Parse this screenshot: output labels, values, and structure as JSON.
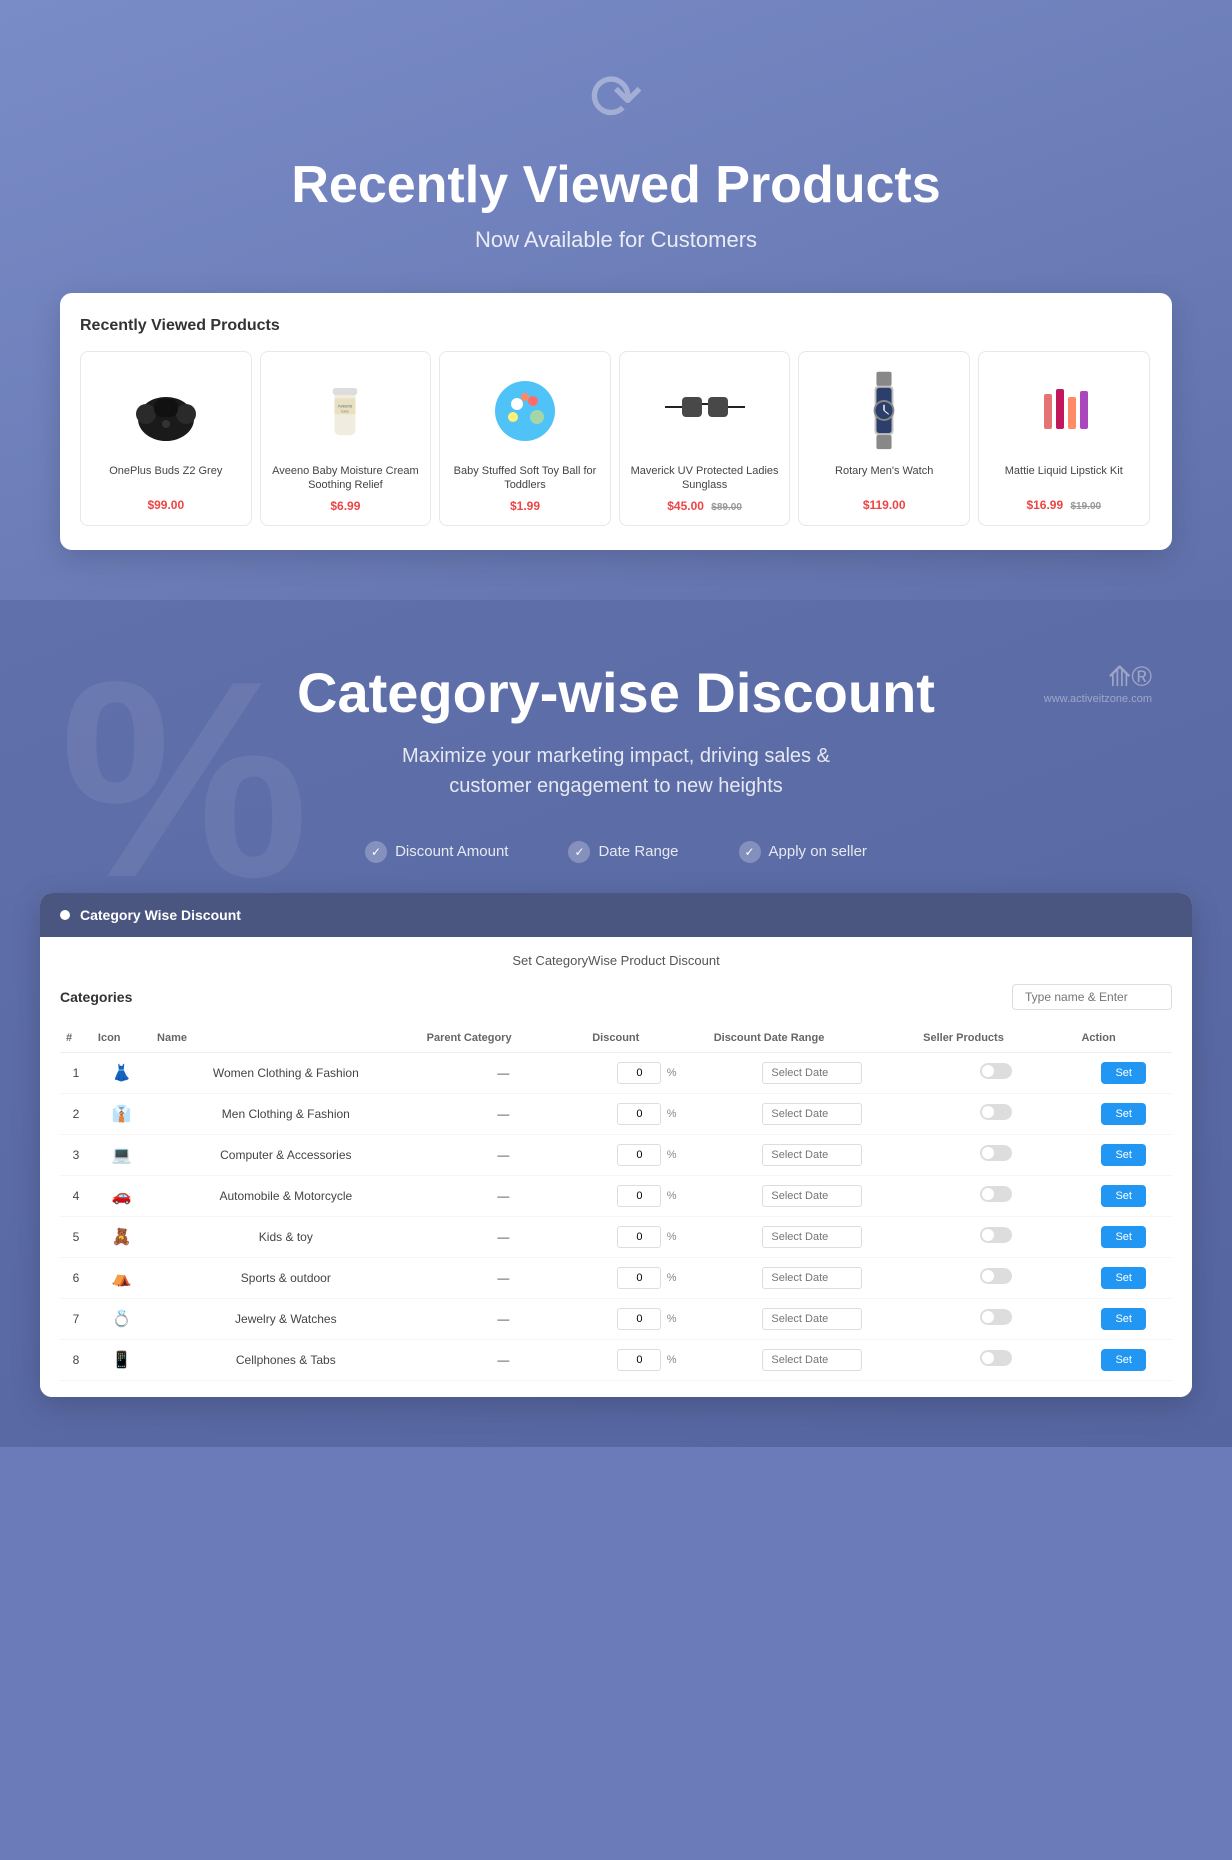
{
  "section1": {
    "icon": "↺",
    "title": "Recently Viewed Products",
    "subtitle": "Now Available for Customers",
    "panel_title": "Recently Viewed Products",
    "products": [
      {
        "name": "OnePlus Buds Z2 Grey",
        "price": "$99.00",
        "old_price": "",
        "icon": "earbuds"
      },
      {
        "name": "Aveeno Baby Moisture Cream Soothing Relief",
        "price": "$6.99",
        "old_price": "",
        "icon": "cream"
      },
      {
        "name": "Baby Stuffed Soft Toy Ball for Toddlers",
        "price": "$1.99",
        "old_price": "",
        "icon": "ball"
      },
      {
        "name": "Maverick UV Protected Ladies Sunglass",
        "price": "$45.00",
        "old_price": "$89.00",
        "icon": "sunglasses"
      },
      {
        "name": "Rotary Men's Watch",
        "price": "$119.00",
        "old_price": "",
        "icon": "watch"
      },
      {
        "name": "Mattie Liquid Lipstick Kit",
        "price": "$16.99",
        "old_price": "$19.00",
        "icon": "lipstick"
      }
    ]
  },
  "section2": {
    "percent_bg": "%",
    "brand_url": "www.activeitzone.com",
    "title": "Category-wise Discount",
    "subtitle": "Maximize your marketing impact, driving sales &\ncustomer engagement to new heights",
    "features": [
      {
        "label": "Discount Amount"
      },
      {
        "label": "Date Range"
      },
      {
        "label": "Apply on seller"
      }
    ],
    "admin": {
      "panel_title": "Category Wise Discount",
      "page_title": "Set CategoryWise Product Discount",
      "categories_label": "Categories",
      "search_placeholder": "Type name & Enter",
      "table": {
        "headers": [
          "#",
          "Icon",
          "Name",
          "Parent Category",
          "Discount",
          "Discount Date Range",
          "Seller Products",
          "Action"
        ],
        "rows": [
          {
            "num": "1",
            "icon": "👗",
            "name": "Women Clothing & Fashion",
            "parent": "—",
            "discount": "0",
            "date": "Select Date",
            "action": "Set"
          },
          {
            "num": "2",
            "icon": "👔",
            "name": "Men Clothing & Fashion",
            "parent": "—",
            "discount": "0",
            "date": "Select Date",
            "action": "Set"
          },
          {
            "num": "3",
            "icon": "💻",
            "name": "Computer & Accessories",
            "parent": "—",
            "discount": "0",
            "date": "Select Date",
            "action": "Set"
          },
          {
            "num": "4",
            "icon": "🚗",
            "name": "Automobile & Motorcycle",
            "parent": "—",
            "discount": "0",
            "date": "Select Date",
            "action": "Set"
          },
          {
            "num": "5",
            "icon": "🧸",
            "name": "Kids & toy",
            "parent": "—",
            "discount": "0",
            "date": "Select Date",
            "action": "Set"
          },
          {
            "num": "6",
            "icon": "⛺",
            "name": "Sports & outdoor",
            "parent": "—",
            "discount": "0",
            "date": "Select Date",
            "action": "Set"
          },
          {
            "num": "7",
            "icon": "💍",
            "name": "Jewelry & Watches",
            "parent": "—",
            "discount": "0",
            "date": "Select Date",
            "action": "Set"
          },
          {
            "num": "8",
            "icon": "📱",
            "name": "Cellphones & Tabs",
            "parent": "—",
            "discount": "0",
            "date": "Select Date",
            "action": "Set"
          }
        ]
      },
      "set_label": "Set"
    }
  }
}
